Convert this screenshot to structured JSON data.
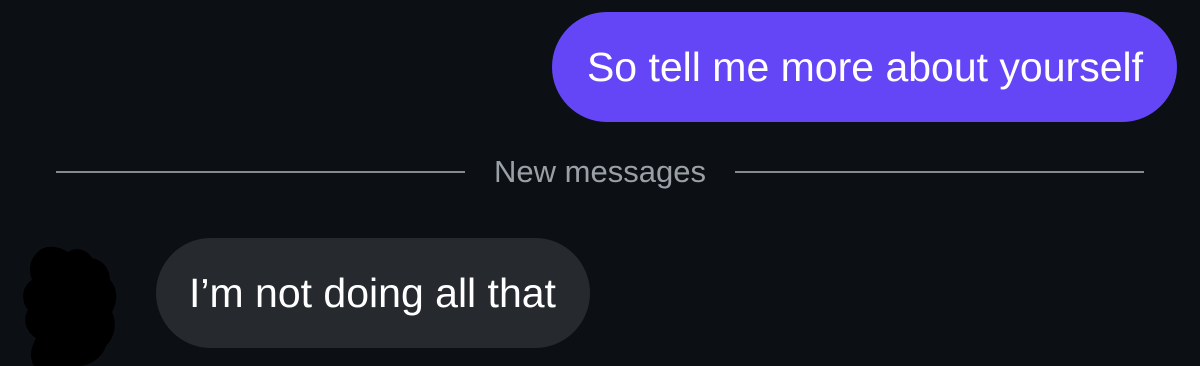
{
  "colors": {
    "background": "#0c1014",
    "sent_bubble": "#6446f7",
    "received_bubble": "#262a2f",
    "divider": "#9aa0a6",
    "redaction": "#000000"
  },
  "messages": [
    {
      "direction": "outgoing",
      "text": "So tell me more about yourself"
    },
    {
      "direction": "incoming",
      "text": "I’m not doing all that"
    }
  ],
  "divider": {
    "label": "New messages"
  },
  "sender": {
    "avatar": "redacted"
  }
}
